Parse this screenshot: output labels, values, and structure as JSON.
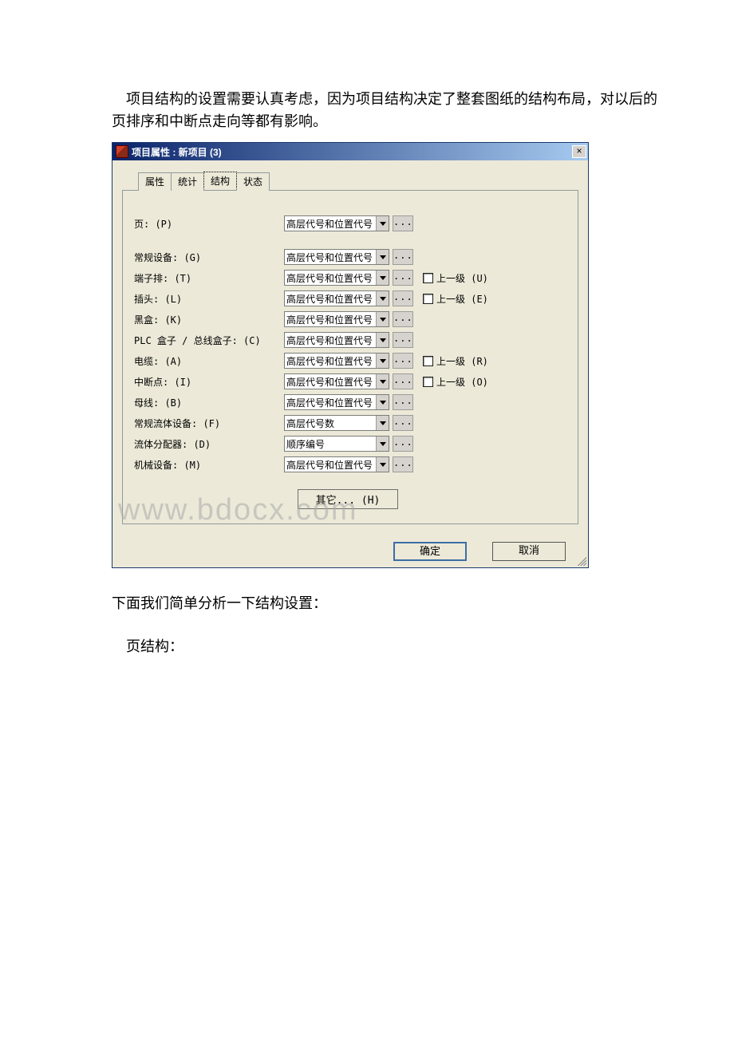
{
  "intro": "　项目结构的设置需要认真考虑，因为项目结构决定了整套图纸的结构布局，对以后的页排序和中断点走向等都有影响。",
  "analysis": "下面我们简单分析一下结构设置：",
  "page_struct": "　页结构：",
  "watermark": "www.bdocx.com",
  "dialog": {
    "title": "项目属性 : 新项目 (3)",
    "close": "×",
    "tabs": [
      "属性",
      "统计",
      "结构",
      "状态"
    ],
    "active_tab": 2,
    "combo_default": "高层代号和位置代号",
    "combo_alt1": "高层代号数",
    "combo_alt2": "顺序编号",
    "ellipsis": "...",
    "rows": [
      {
        "label": "页:  (P)",
        "value_key": "combo_default",
        "upper": null
      },
      {
        "label": "常规设备:  (G)",
        "value_key": "combo_default",
        "upper": null
      },
      {
        "label": "端子排:  (T)",
        "value_key": "combo_default",
        "upper": "上一级  (U)"
      },
      {
        "label": "插头:  (L)",
        "value_key": "combo_default",
        "upper": "上一级  (E)"
      },
      {
        "label": "黑盒:  (K)",
        "value_key": "combo_default",
        "upper": null
      },
      {
        "label": "PLC 盒子 / 总线盒子:  (C)",
        "value_key": "combo_default",
        "upper": null
      },
      {
        "label": "电缆:  (A)",
        "value_key": "combo_default",
        "upper": "上一级  (R)"
      },
      {
        "label": "中断点:  (I)",
        "value_key": "combo_default",
        "upper": "上一级  (O)"
      },
      {
        "label": "母线:  (B)",
        "value_key": "combo_default",
        "upper": null
      },
      {
        "label": "常规流体设备:  (F)",
        "value_key": "combo_alt1",
        "upper": null
      },
      {
        "label": "流体分配器:  (D)",
        "value_key": "combo_alt2",
        "upper": null
      },
      {
        "label": "机械设备:  (M)",
        "value_key": "combo_default",
        "upper": null
      }
    ],
    "other_btn": "其它... (H)",
    "ok": "确定",
    "cancel": "取消"
  }
}
